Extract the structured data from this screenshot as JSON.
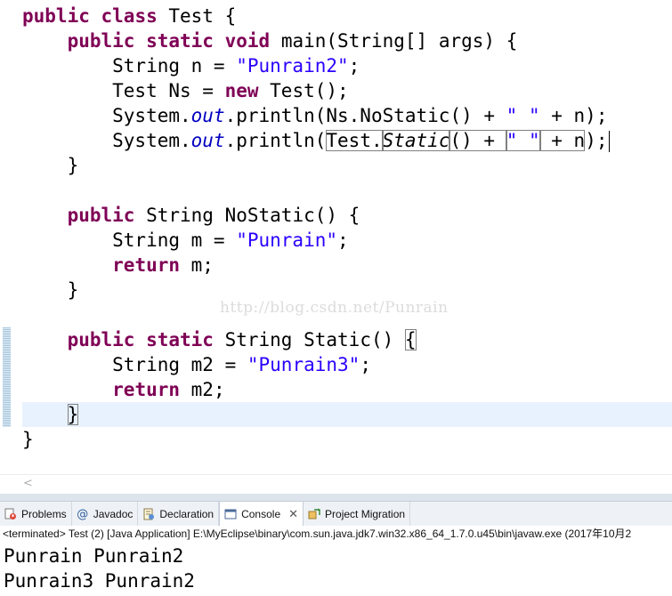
{
  "editor": {
    "lines": [
      [
        {
          "c": "kw",
          "t": "public"
        },
        {
          "t": " "
        },
        {
          "c": "kw",
          "t": "class"
        },
        {
          "t": " Test {"
        }
      ],
      [
        {
          "t": "    "
        },
        {
          "c": "kw",
          "t": "public"
        },
        {
          "t": " "
        },
        {
          "c": "kw",
          "t": "static"
        },
        {
          "t": " "
        },
        {
          "c": "kw",
          "t": "void"
        },
        {
          "t": " main(String[] args) {"
        }
      ],
      [
        {
          "t": "        String n = "
        },
        {
          "c": "str",
          "t": "\"Punrain2\""
        },
        {
          "t": ";"
        }
      ],
      [
        {
          "t": "        Test Ns = "
        },
        {
          "c": "kw",
          "t": "new"
        },
        {
          "t": " Test();"
        }
      ],
      [
        {
          "t": "        System."
        },
        {
          "c": "fld",
          "t": "out"
        },
        {
          "t": ".println(Ns.NoStatic() + "
        },
        {
          "c": "str",
          "t": "\" \""
        },
        {
          "t": " + n);"
        }
      ],
      [
        {
          "t": "        System."
        },
        {
          "c": "fld",
          "t": "out"
        },
        {
          "t": ".println("
        },
        {
          "c": "boxed",
          "t": "Test."
        },
        {
          "c": "boxed ital",
          "t": "Static"
        },
        {
          "c": "boxed",
          "t": "() + "
        },
        {
          "c": "boxed str",
          "t": "\" \""
        },
        {
          "c": "boxed",
          "t": " + n"
        },
        {
          "t": ");"
        },
        {
          "c": "caret",
          "t": ""
        }
      ],
      [
        {
          "t": "    }"
        }
      ],
      [
        {
          "t": ""
        }
      ],
      [
        {
          "t": "    "
        },
        {
          "c": "kw",
          "t": "public"
        },
        {
          "t": " String NoStatic() {"
        }
      ],
      [
        {
          "t": "        String m = "
        },
        {
          "c": "str",
          "t": "\"Punrain\""
        },
        {
          "t": ";"
        }
      ],
      [
        {
          "t": "        "
        },
        {
          "c": "kw",
          "t": "return"
        },
        {
          "t": " m;"
        }
      ],
      [
        {
          "t": "    }"
        }
      ],
      [
        {
          "t": ""
        }
      ],
      [
        {
          "t": "    "
        },
        {
          "c": "kw",
          "t": "public"
        },
        {
          "t": " "
        },
        {
          "c": "kw",
          "t": "static"
        },
        {
          "t": " String Static() "
        },
        {
          "c": "boxed",
          "t": "{"
        }
      ],
      [
        {
          "t": "        String m2 = "
        },
        {
          "c": "str",
          "t": "\"Punrain3\""
        },
        {
          "t": ";"
        }
      ],
      [
        {
          "t": "        "
        },
        {
          "c": "kw",
          "t": "return"
        },
        {
          "t": " m2;"
        }
      ],
      [
        {
          "t": "    "
        },
        {
          "c": "boxed",
          "t": "}"
        }
      ],
      [
        {
          "t": "}"
        }
      ]
    ],
    "watermark": "http://blog.csdn.net/Punrain",
    "scroll_arrow": "<"
  },
  "tabs": [
    {
      "id": "problems",
      "label": "Problems",
      "icon": "problems-icon",
      "active": false
    },
    {
      "id": "javadoc",
      "label": "Javadoc",
      "icon": "javadoc-icon",
      "active": false
    },
    {
      "id": "declaration",
      "label": "Declaration",
      "icon": "declaration-icon",
      "active": false
    },
    {
      "id": "console",
      "label": "Console",
      "icon": "console-icon",
      "active": true,
      "close": "✕"
    },
    {
      "id": "project-migration",
      "label": "Project Migration",
      "icon": "project-migration-icon",
      "active": false
    }
  ],
  "console": {
    "status": "<terminated> Test (2) [Java Application] E:\\MyEclipse\\binary\\com.sun.java.jdk7.win32.x86_64_1.7.0.u45\\bin\\javaw.exe (2017年10月2",
    "output": [
      "Punrain Punrain2",
      "Punrain3 Punrain2"
    ]
  },
  "colors": {
    "keyword": "#7f0055",
    "string": "#2a00ff",
    "field": "#0000c0",
    "current_line": "#e8f2fe"
  }
}
